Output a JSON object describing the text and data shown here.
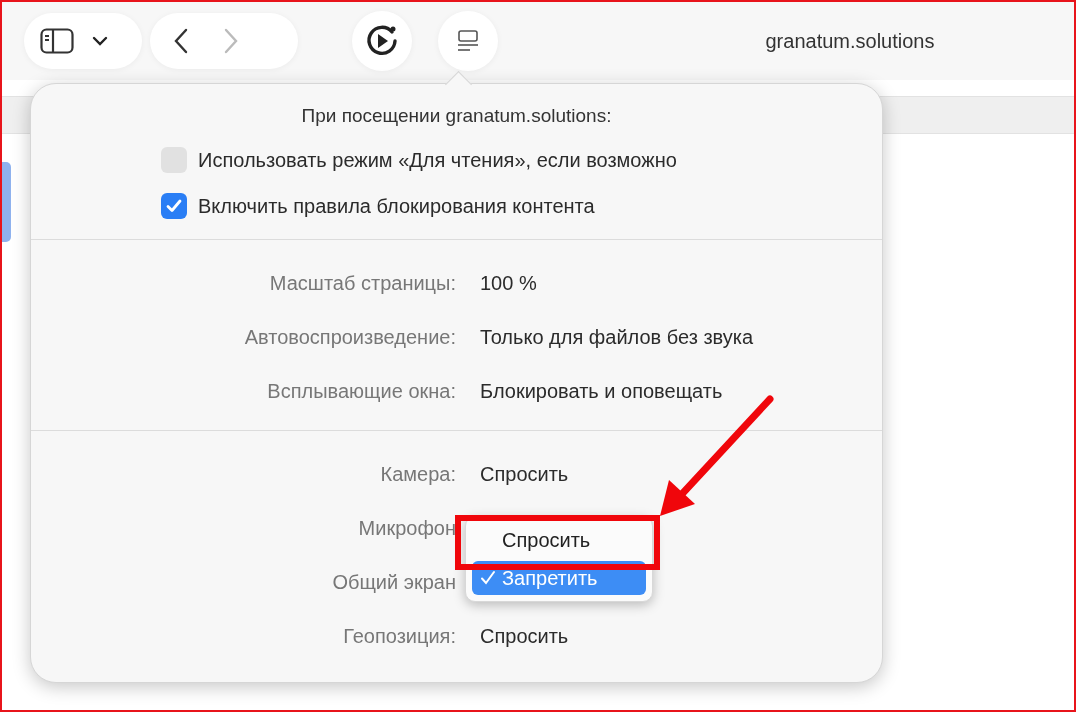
{
  "toolbar": {
    "address": "granatum.solutions"
  },
  "popover": {
    "title": "При посещении granatum.solutions:",
    "options": [
      {
        "label": "Использовать режим «Для чтения», если возможно",
        "checked": false
      },
      {
        "label": "Включить правила блокирования контента",
        "checked": true
      }
    ],
    "settings": [
      {
        "label": "Масштаб страницы:",
        "value": "100 %"
      },
      {
        "label": "Автовоспроизведение:",
        "value": "Только для файлов без звука"
      },
      {
        "label": "Всплывающие окна:",
        "value": "Блокировать и оповещать"
      }
    ],
    "permissions": [
      {
        "label": "Камера:",
        "value": "Спросить"
      },
      {
        "label": "Микрофон"
      },
      {
        "label": "Общий экран"
      },
      {
        "label": "Геопозиция:",
        "value": "Спросить"
      }
    ],
    "menu": {
      "items": [
        {
          "label": "Спросить",
          "selected": false
        },
        {
          "label": "Запретить",
          "selected": true
        }
      ]
    }
  }
}
